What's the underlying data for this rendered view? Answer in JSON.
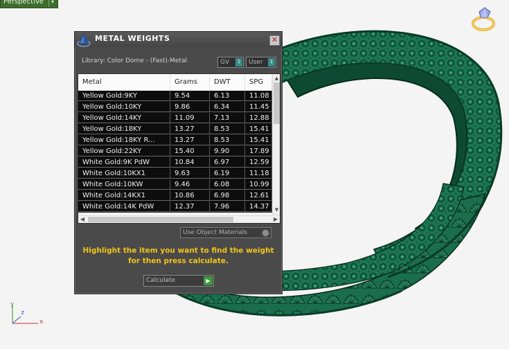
{
  "viewport": {
    "label": "Perspective",
    "dropdown_glyph": "▾",
    "axes": {
      "y": "y",
      "z": "z",
      "x": "x"
    },
    "logo_icon": "ring-logo-icon"
  },
  "dialog": {
    "title": "METAL WEIGHTS",
    "close_glyph": "✕",
    "library_label": "Library: Color Dome - (Fast)-Metal",
    "toggles": [
      {
        "label": "GV",
        "knob": "I"
      },
      {
        "label": "User",
        "knob": "I"
      }
    ],
    "table": {
      "columns": [
        "Metal",
        "Grams",
        "DWT",
        "SPG"
      ],
      "rows": [
        [
          "Yellow Gold:9KY",
          "9.54",
          "6.13",
          "11.08"
        ],
        [
          "Yellow Gold:10KY",
          "9.86",
          "6.34",
          "11.45"
        ],
        [
          "Yellow Gold:14KY",
          "11.09",
          "7.13",
          "12.88"
        ],
        [
          "Yellow Gold:18KY",
          "13.27",
          "8.53",
          "15.41"
        ],
        [
          "Yellow Gold:18KY R...",
          "13.27",
          "8.53",
          "15.41"
        ],
        [
          "Yellow Gold:22KY",
          "15.40",
          "9.90",
          "17.89"
        ],
        [
          "White Gold:9K PdW",
          "10.84",
          "6.97",
          "12.59"
        ],
        [
          "White Gold:10KX1",
          "9.63",
          "6.19",
          "11.18"
        ],
        [
          "White Gold:10KW",
          "9.46",
          "6.08",
          "10.99"
        ],
        [
          "White Gold:14KX1",
          "10.86",
          "6.98",
          "12.61"
        ],
        [
          "White Gold:14K PdW",
          "12.37",
          "7.96",
          "14.37"
        ]
      ]
    },
    "use_object_materials_label": "Use Object Materials",
    "instructions": "Highlight the item you want to find the weight for then press calculate.",
    "calculate_label": "Calculate",
    "go_glyph": "▶",
    "scroll_glyphs": {
      "up": "▲",
      "down": "▼",
      "left": "◀",
      "right": "▶"
    }
  },
  "colors": {
    "ring_green": "#1e7a56",
    "viewport_bg": "#f4f4f4",
    "dialog_bg": "#4a4a4a",
    "instruction_text": "#f0c419",
    "accent_teal": "#3a8d8b"
  }
}
